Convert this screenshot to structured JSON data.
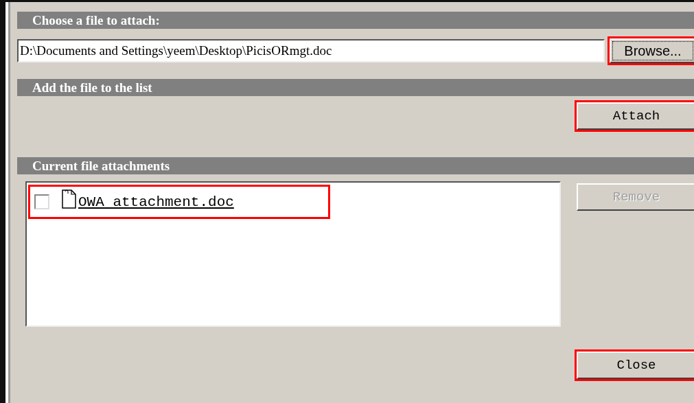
{
  "choose_header": "Choose a file to attach:",
  "file_field": {
    "value": "D:\\Documents and Settings\\yeem\\Desktop\\PicisORmgt.doc"
  },
  "browse_button": {
    "label": "Browse...",
    "highlighted": true,
    "disabled": false
  },
  "add_header": "Add the file to the list",
  "attach_button": {
    "label": "Attach",
    "highlighted": true,
    "disabled": false
  },
  "attachments_header": "Current file attachments",
  "attachments": [
    {
      "name": "OWA attachment.doc",
      "checked": false,
      "highlighted": true
    }
  ],
  "remove_button": {
    "label": "Remove",
    "highlighted": false,
    "disabled": true
  },
  "close_button": {
    "label": "Close",
    "highlighted": true,
    "disabled": false
  }
}
